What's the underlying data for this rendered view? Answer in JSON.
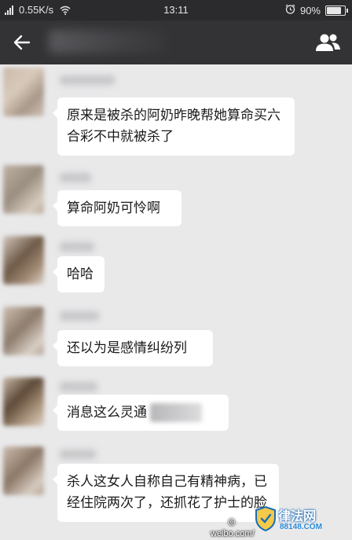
{
  "status_bar": {
    "speed": "0.55K/s",
    "time": "13:11",
    "battery": "90%",
    "battery_level": 0.9
  },
  "messages": [
    {
      "text": "原来是被杀的阿奶昨晚帮她算命买六合彩不中就被杀了"
    },
    {
      "text": "算命阿奶可怜啊"
    },
    {
      "text": "哈哈"
    },
    {
      "text": "还以为是感情纠纷列"
    },
    {
      "text": "消息这么灵通"
    },
    {
      "text": "杀人这女人自称自己有精神病，已经住院两次了，还抓花了护士的脸"
    }
  ],
  "watermark": {
    "url": "weibo.com/",
    "logo_text": "律法网",
    "logo_sub": "88148.COM"
  }
}
